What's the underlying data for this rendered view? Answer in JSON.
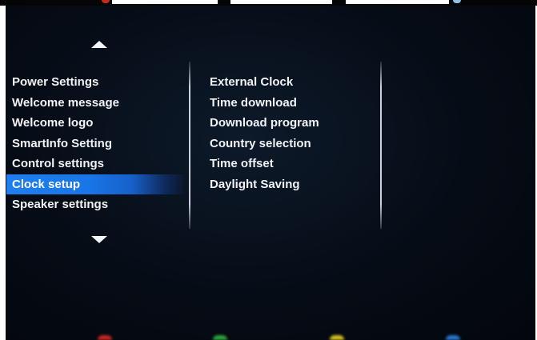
{
  "menu": {
    "items": [
      {
        "label": "Power Settings"
      },
      {
        "label": "Welcome message"
      },
      {
        "label": "Welcome logo"
      },
      {
        "label": "SmartInfo Setting"
      },
      {
        "label": "Control settings"
      },
      {
        "label": "Clock setup",
        "selected": true
      },
      {
        "label": "Speaker settings"
      }
    ]
  },
  "submenu": {
    "items": [
      {
        "label": "External Clock"
      },
      {
        "label": "Time download"
      },
      {
        "label": "Download program"
      },
      {
        "label": "Country selection"
      },
      {
        "label": "Time offset"
      },
      {
        "label": "Daylight Saving"
      }
    ]
  },
  "colors": {
    "selection": "#1e7ff0",
    "background": "#060c16",
    "text": "#f1f3f6",
    "key_red": "#c8281e",
    "key_green": "#2aa63a",
    "key_yellow": "#d6c21e",
    "key_blue": "#2a78d0"
  },
  "icons": {
    "scroll_up": "triangle-up-icon",
    "scroll_down": "triangle-down-icon"
  }
}
